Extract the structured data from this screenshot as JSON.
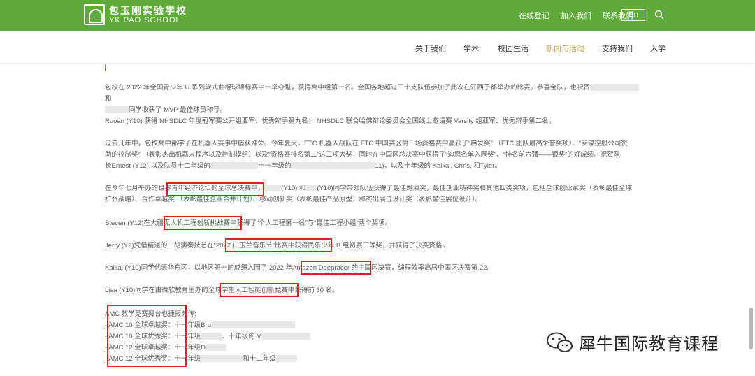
{
  "header": {
    "school_name_cn": "包玉刚实验学校",
    "school_name_en": "YK PAO SCHOOL",
    "links": [
      "在线登记",
      "加入我们",
      "联系我们"
    ],
    "lang_button": "En"
  },
  "nav": {
    "items": [
      "关于我们",
      "学术",
      "校园生活",
      "新闻与活动",
      "支持我们",
      "入学"
    ],
    "active": "新闻与活动"
  },
  "article": {
    "p1": "包校在 2022 年全国青少年 U 系列软式曲棍球锦标赛中一举夺魁，获得高中组第一名。全国各地超过三十支队伍参加了此次在江西于都举办的比赛。恭喜全队，也祝贺",
    "p1_end": "和",
    "p1_line2": "同学收获了 MVP 最佳球员称号。",
    "p2": "Ruoan (Y10) 获得 NHSDLC 年度冠军赛公开组亚军、优秀辩手第九名； NHSDLC 联合哈佛辩论委员会全国线上邀请赛 Varsity 组亚军、优秀辩手第二名。",
    "p3_l1": "过去几年中，包校高中部学子在机器人赛事中屡获殊荣。今年夏天，FTC 机器人战队在 FTC 中国赛区第三场资格赛中赢获了“启发奖” （FTC 团队最高荣誉奖项）、“安谋控股公司赞",
    "p3_l2": "助的控制奖” （表彰杰出机器人程序以及控制模组）以及“资格赛排名第二”这三项大奖，同时在中国区总决赛中获得了“迪恩名单入围奖”、“排名前六强——银奖”的好成绩。祝贺队",
    "p3_l3a": "长Ernest (Y12) 以及队员十二年级的",
    "p3_l3b": "十一年级的",
    "p3_l3c": "11)，以及十年级的 Kaikai, Chris, 和Tyler。",
    "p4_l1a": "在今年七月举办的",
    "p4_l1b": "世界青年经济论坛的全球总决赛",
    "p4_l1c": "中，",
    "p4_l1d": "(Y10) 和",
    "p4_l1e": "(Y10)同学带领队伍获得了最佳路演奖，最佳创业精神奖和其他四类奖项，包括全球创业家奖（表彰最佳全球",
    "p4_l2": "扩张战略）、合作卓越奖 （表彰最佳企业合并计划）、移动创新奖（表彰最佳产品原型）和杰出展位设计奖（表彰最佳展位设计）。",
    "p5a": "Steven (Y12)在",
    "p5b": "大疆无人机工程创新挑战赛",
    "p5c": "中获得了“个人工程第一名”与“最佳工程小组”两个奖项。",
    "p6a": "Jerry (Y9)凭借精湛的二胡演奏技艺在",
    "p6b": "“2022 白玉兰音乐节”",
    "p6c": "比赛中获得民乐少年 B 组初赛三等奖，并获得了决赛资格。",
    "p7a": "Kaikai (Y10)同学代表华东区，以地区第一的成绩入围了 2022 年",
    "p7b": "Amazon Deepracer",
    "p7c": " 的中国区决赛，编程效率高居中国区决赛第 22。",
    "p8a": "Lisa (Y10)同学在由微软教育主办的",
    "p8b": "全球学生人工智能创新竞赛",
    "p8c": "中获得前 30 名。",
    "amc_title": "AMC 数学竞赛舞台也捷报频传:",
    "amc_items": [
      {
        "label": "· AMC 10 全球卓越奖：",
        "detail": "十一年级Bru"
      },
      {
        "label": "· AMC 10 全球优秀奖：",
        "detail": "十一年级",
        "extra": "、十年级的 V"
      },
      {
        "label": "· AMC 12 全球卓越奖：",
        "detail": "十一年级D"
      },
      {
        "label": "· AMC 12 全球优秀奖：",
        "detail": "十一年级",
        "extra": "和十二年级"
      }
    ]
  },
  "watermark": "犀牛国际教育课程",
  "colors": {
    "header_green": "#5eab3a",
    "nav_active": "#c9a53a",
    "highlight_box": "#e02020"
  },
  "icons": [
    "tree-logo-icon",
    "search-icon",
    "wechat-icon"
  ]
}
